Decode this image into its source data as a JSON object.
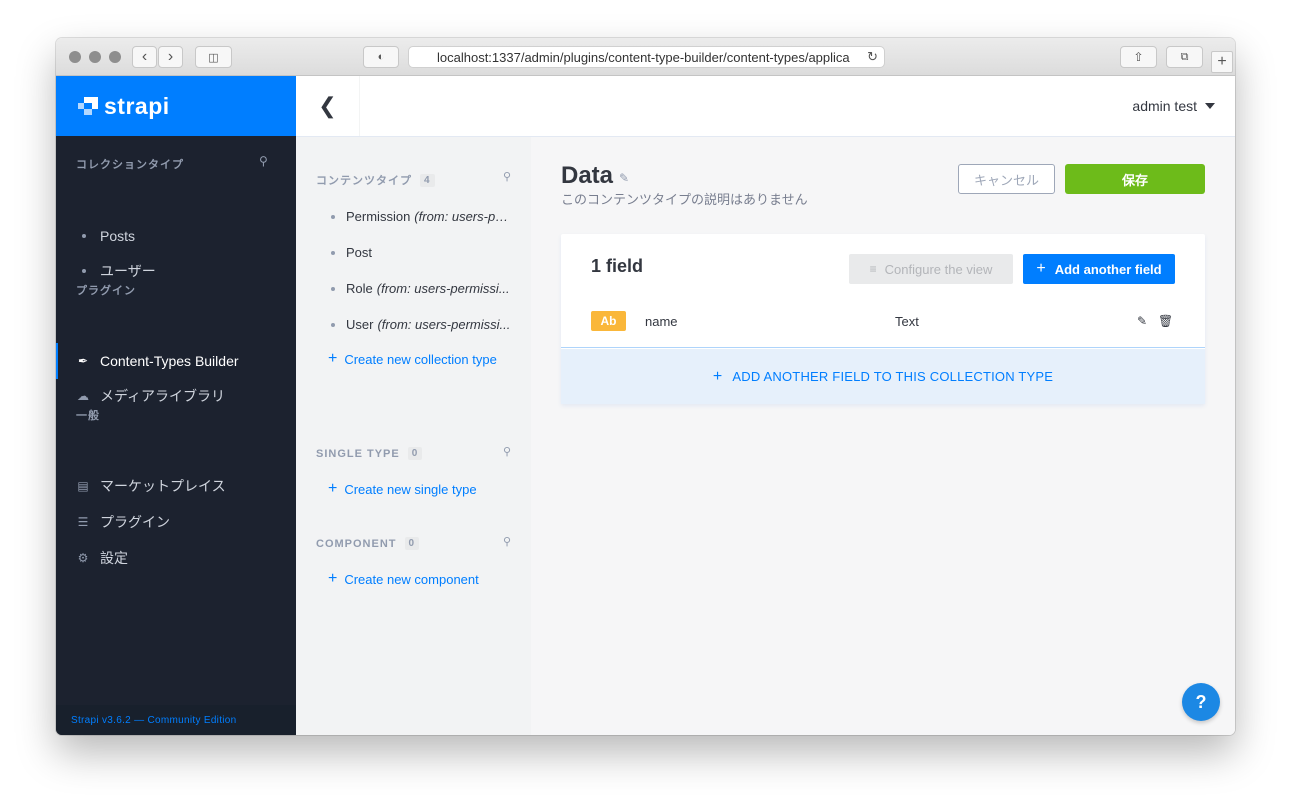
{
  "browser": {
    "url": "localhost:1337/admin/plugins/content-type-builder/content-types/applica"
  },
  "brand": {
    "name": "strapi"
  },
  "leftnav": {
    "sections": [
      {
        "title": "コレクションタイプ",
        "items": [
          {
            "label": "Posts"
          },
          {
            "label": "ユーザー"
          }
        ]
      },
      {
        "title": "プラグイン",
        "items": [
          {
            "label": "Content-Types Builder",
            "icon": "brush-icon",
            "active": true
          },
          {
            "label": "メディアライブラリ",
            "icon": "cloud-upload-icon"
          }
        ]
      },
      {
        "title": "一般",
        "items": [
          {
            "label": "マーケットプレイス",
            "icon": "basket-icon"
          },
          {
            "label": "プラグイン",
            "icon": "list-icon"
          },
          {
            "label": "設定",
            "icon": "gear-icon"
          }
        ]
      }
    ],
    "version": "Strapi v3.6.2 — Community Edition"
  },
  "topbar": {
    "user": "admin test"
  },
  "subnav": {
    "content_types": {
      "title": "コンテンツタイプ",
      "count": "4",
      "items": [
        {
          "name": "Permission",
          "from": "(from: users-pe..."
        },
        {
          "name": "Post",
          "from": ""
        },
        {
          "name": "Role",
          "from": "(from: users-permissi..."
        },
        {
          "name": "User",
          "from": "(from: users-permissi..."
        }
      ],
      "create": "Create new collection type"
    },
    "single_type": {
      "title": "SINGLE TYPE",
      "count": "0",
      "create": "Create new single type"
    },
    "component": {
      "title": "COMPONENT",
      "count": "0",
      "create": "Create new component"
    }
  },
  "main": {
    "title": "Data",
    "subtitle": "このコンテンツタイプの説明はありません",
    "cancel": "キャンセル",
    "save": "保存",
    "fields_count": "1 field",
    "configure_view": "Configure the view",
    "add_field": "Add another field",
    "fields": [
      {
        "badge": "Ab",
        "name": "name",
        "type": "Text"
      }
    ],
    "add_bar": "ADD ANOTHER FIELD TO THIS COLLECTION TYPE",
    "help": "?"
  },
  "colors": {
    "brand_blue": "#007eff",
    "sidebar_bg": "#1c222f",
    "save_green": "#6dbb1a",
    "badge_orange": "#fab73a"
  }
}
